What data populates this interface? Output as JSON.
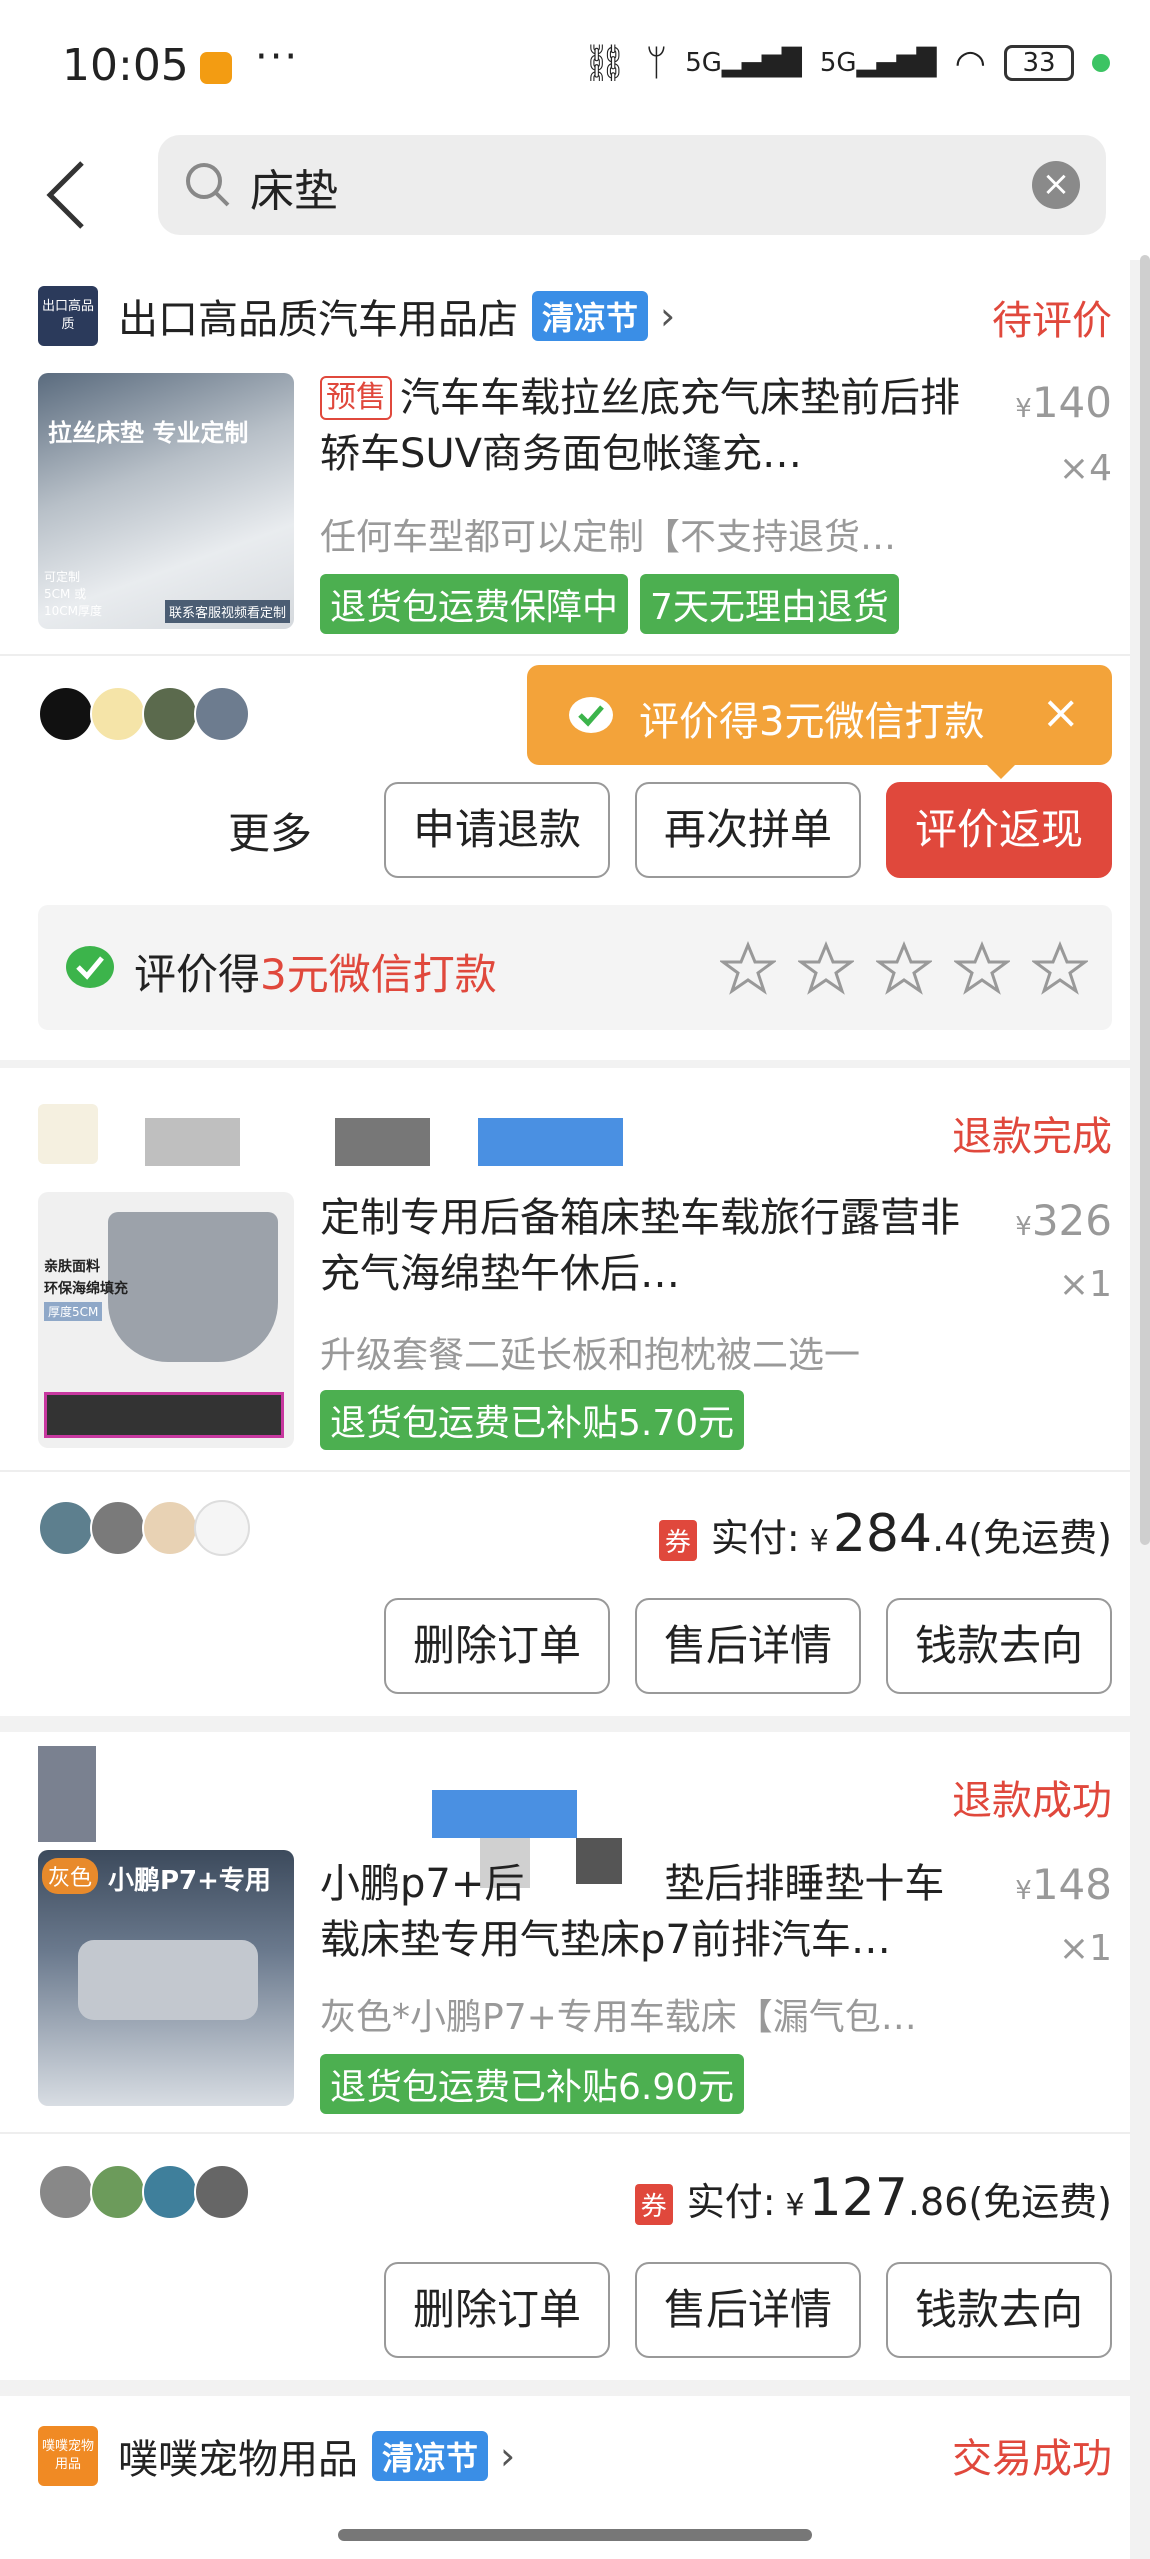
{
  "status_bar": {
    "time": "10:05",
    "dots": "···",
    "signal": "5G",
    "signal2": "5G",
    "battery": "33"
  },
  "search": {
    "query": "床垫"
  },
  "orders": [
    {
      "shop": "出口高品质汽车用品店",
      "shop_logo_text": "出口高品质",
      "festival": "清凉节",
      "status": "待评价",
      "pre_tag": "预售",
      "title": "汽车车载拉丝底充气床垫前后排轿车SUV商务面包帐篷充…",
      "price_symbol": "¥",
      "price": "140",
      "qty": "×4",
      "sku": "任何车型都可以定制【不支持退货…",
      "tags": [
        "退货包运费保障中",
        "7天无理由退货"
      ],
      "thumb_text": "拉丝床垫 专业定制",
      "thumb_small": "可定制5CM 或10CM厚度",
      "thumb_footer": "联系客服视频看定制",
      "buttons": {
        "more": "更多",
        "refund": "申请退款",
        "rebuy": "再次拼单",
        "review": "评价返现"
      },
      "tooltip": "评价得3元微信打款",
      "review_prefix": "评价得",
      "review_highlight": "3元微信打款"
    },
    {
      "status": "退款完成",
      "title": "定制专用后备箱床垫车载旅行露营非充气海绵垫午休后…",
      "price_symbol": "¥",
      "price": "326",
      "qty": "×1",
      "sku": "升级套餐二延长板和抱枕被二选一",
      "tags": [
        "退货包运费已补贴5.70元"
      ],
      "thumb_label1": "亲肤面料",
      "thumb_label2": "环保海绵填充",
      "thumb_label3": "厚度5CM",
      "coupon": "券",
      "pay_label": "实付:",
      "pay_symbol": "¥",
      "pay_int": "284",
      "pay_dec": ".4",
      "pay_note": "(免运费)",
      "buttons": {
        "delete": "删除订单",
        "after_sale": "售后详情",
        "money_flow": "钱款去向"
      }
    },
    {
      "status": "退款成功",
      "title": "小鹏p7+后排…垫后排睡垫十车载床垫专用气垫床p7前排汽车…",
      "title_line1": "小鹏p7+后",
      "title_line1b": "垫后排睡垫十车",
      "title_line2": "载床垫专用气垫床p7前排汽车…",
      "price_symbol": "¥",
      "price": "148",
      "qty": "×1",
      "sku": "灰色*小鹏P7+专用车载床【漏气包…",
      "tags": [
        "退货包运费已补贴6.90元"
      ],
      "thumb_tag": "灰色",
      "thumb_text": "小鹏P7+专用",
      "coupon": "券",
      "pay_label": "实付:",
      "pay_symbol": "¥",
      "pay_int": "127",
      "pay_dec": ".86",
      "pay_note": "(免运费)",
      "buttons": {
        "delete": "删除订单",
        "after_sale": "售后详情",
        "money_flow": "钱款去向"
      }
    },
    {
      "shop": "噗噗宠物用品",
      "shop_logo_text": "噗噗宠物用品",
      "festival": "清凉节",
      "status": "交易成功"
    }
  ]
}
